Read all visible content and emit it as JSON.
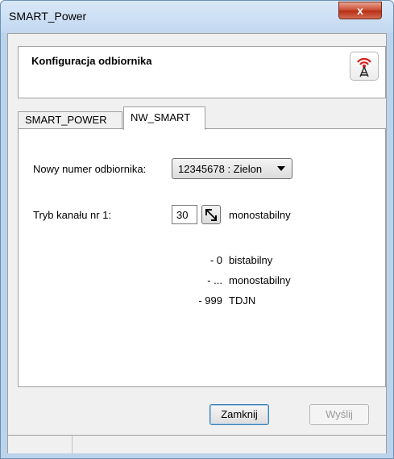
{
  "window": {
    "title": "SMART_Power",
    "close_glyph": "x"
  },
  "header": {
    "title": "Konfiguracja odbiornika",
    "icon": "antenna-signal-icon"
  },
  "tabs": [
    {
      "label": "SMART_POWER",
      "active": false
    },
    {
      "label": "NW_SMART",
      "active": true
    }
  ],
  "form": {
    "receiver_label": "Nowy numer odbiornika:",
    "receiver_value": "12345678 : Zielon",
    "channel_label": "Tryb kanału nr 1:",
    "channel_value": "30",
    "channel_mode": "monostabilny"
  },
  "legend": [
    {
      "value": "- 0",
      "desc": "bistabilny"
    },
    {
      "value": "- ...",
      "desc": "monostabilny"
    },
    {
      "value": "- 999",
      "desc": "TDJN"
    }
  ],
  "buttons": {
    "close_label": "Zamknij",
    "send_label": "Wyślij"
  },
  "colors": {
    "accent": "#3c7fb1",
    "close_button": "#c9472e",
    "icon_red": "#d42020"
  }
}
